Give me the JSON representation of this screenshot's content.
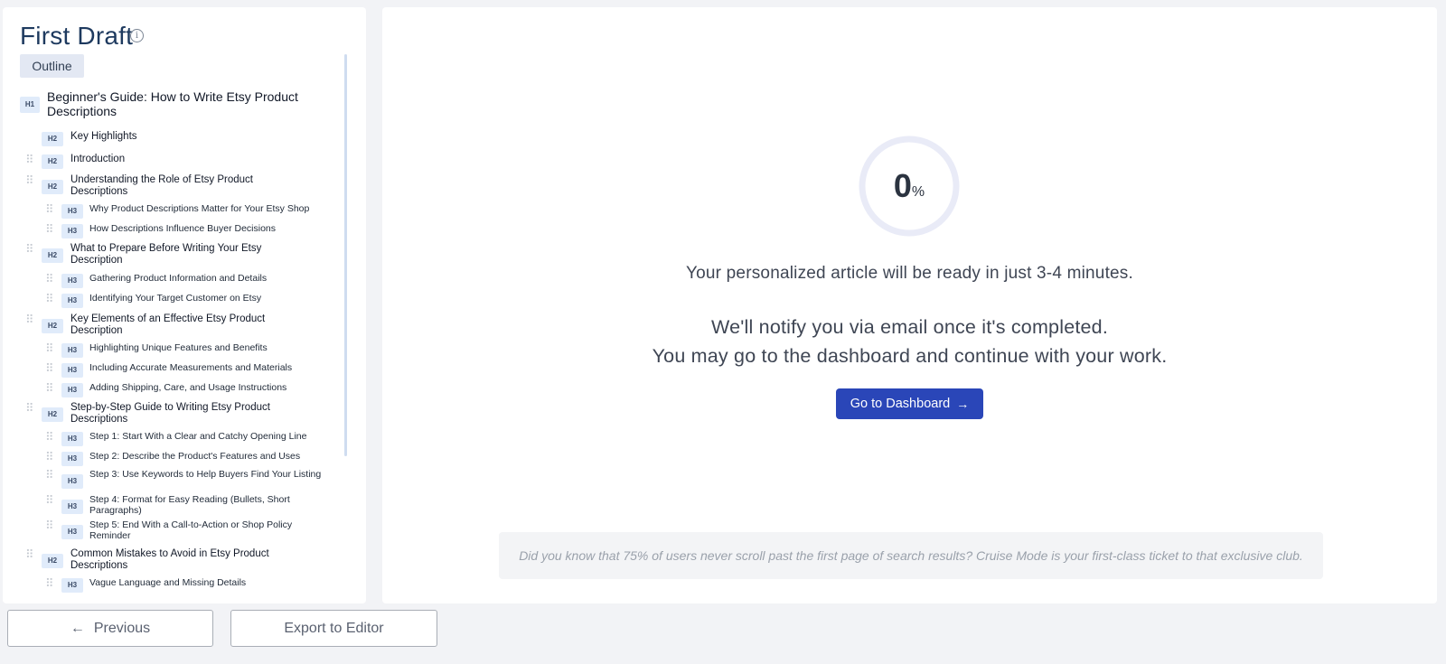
{
  "panel": {
    "title": "First Draft",
    "info_icon": "info-icon",
    "tab_outline": "Outline"
  },
  "outline": [
    {
      "level": "H1",
      "text": "Beginner's Guide: How to Write Etsy Product Descriptions"
    },
    {
      "level": "H2",
      "text": "Key Highlights"
    },
    {
      "level": "H2",
      "text": "Introduction"
    },
    {
      "level": "H2",
      "text": "Understanding the Role of Etsy Product Descriptions"
    },
    {
      "level": "H3",
      "text": "Why Product Descriptions Matter for Your Etsy Shop"
    },
    {
      "level": "H3",
      "text": "How Descriptions Influence Buyer Decisions"
    },
    {
      "level": "H2",
      "text": "What to Prepare Before Writing Your Etsy Description"
    },
    {
      "level": "H3",
      "text": "Gathering Product Information and Details"
    },
    {
      "level": "H3",
      "text": "Identifying Your Target Customer on Etsy"
    },
    {
      "level": "H2",
      "text": "Key Elements of an Effective Etsy Product Description"
    },
    {
      "level": "H3",
      "text": "Highlighting Unique Features and Benefits"
    },
    {
      "level": "H3",
      "text": "Including Accurate Measurements and Materials"
    },
    {
      "level": "H3",
      "text": "Adding Shipping, Care, and Usage Instructions"
    },
    {
      "level": "H2",
      "text": "Step-by-Step Guide to Writing Etsy Product Descriptions"
    },
    {
      "level": "H3",
      "text": "Step 1: Start With a Clear and Catchy Opening Line"
    },
    {
      "level": "H3",
      "text": "Step 2: Describe the Product's Features and Uses"
    },
    {
      "level": "H3",
      "text": "Step 3: Use Keywords to Help Buyers Find Your Listing"
    },
    {
      "level": "H3",
      "text": "Step 4: Format for Easy Reading (Bullets, Short Paragraphs)"
    },
    {
      "level": "H3",
      "text": "Step 5: End With a Call-to-Action or Shop Policy Reminder"
    },
    {
      "level": "H2",
      "text": "Common Mistakes to Avoid in Etsy Product Descriptions"
    },
    {
      "level": "H3",
      "text": "Vague Language and Missing Details"
    }
  ],
  "status": {
    "progress_value": "0",
    "progress_unit": "%",
    "progress_fraction": 0,
    "ready_text": "Your personalized article will be ready in just 3-4 minutes.",
    "notify_text": "We'll notify you via email once it's completed.",
    "continue_text": "You may go to the dashboard and continue with your work.",
    "dashboard_button": "Go to Dashboard",
    "dashboard_icon": "arrow-right-icon",
    "tip": "Did you know that 75% of users never scroll past the first page of search results? Cruise Mode is your first-class ticket to that exclusive club."
  },
  "footer": {
    "previous_label": "Previous",
    "previous_icon": "arrow-left-icon",
    "export_label": "Export to Editor"
  },
  "colors": {
    "primary_button": "#2a46b8",
    "progress_track": "#e9ebf7",
    "tag_bg": "#e0ebfa"
  }
}
